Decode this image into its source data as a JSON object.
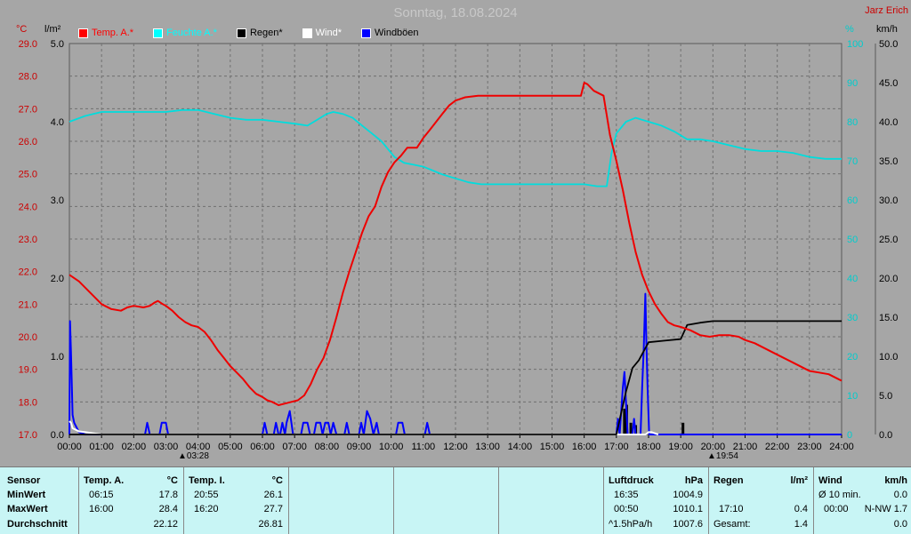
{
  "header": {
    "title": "Sonntag, 18.08.2024",
    "station": "Jarz Erich"
  },
  "units": {
    "temp": "°C",
    "rain": "l/m²",
    "humidity": "%",
    "wind": "km/h"
  },
  "legend": [
    {
      "label": "Temp. A.*",
      "color": "#ff0000"
    },
    {
      "label": "Feuchte A.*",
      "color": "#00ffff"
    },
    {
      "label": "Regen*",
      "color": "#000000"
    },
    {
      "label": "Wind*",
      "color": "#ffffff"
    },
    {
      "label": "Windböen",
      "color": "#0000ff"
    }
  ],
  "sun": {
    "rise": "03:28",
    "set": "19:54"
  },
  "chart_data": {
    "type": "line",
    "x_ticks": [
      "00:00",
      "01:00",
      "02:00",
      "03:00",
      "04:00",
      "05:00",
      "06:00",
      "07:00",
      "08:00",
      "09:00",
      "10:00",
      "11:00",
      "12:00",
      "13:00",
      "14:00",
      "15:00",
      "16:00",
      "17:00",
      "18:00",
      "19:00",
      "20:00",
      "21:00",
      "22:00",
      "23:00",
      "24:00"
    ],
    "axes": {
      "temp": {
        "ticks": [
          "17.0",
          "18.0",
          "19.0",
          "20.0",
          "21.0",
          "22.0",
          "23.0",
          "24.0",
          "25.0",
          "26.0",
          "27.0",
          "28.0",
          "29.0"
        ],
        "range": [
          17,
          29
        ]
      },
      "rain": {
        "ticks": [
          "0.0",
          "1.0",
          "2.0",
          "3.0",
          "4.0",
          "5.0"
        ],
        "range": [
          0,
          5
        ]
      },
      "humidity": {
        "ticks": [
          "0",
          "10",
          "20",
          "30",
          "40",
          "50",
          "60",
          "70",
          "80",
          "90",
          "100"
        ],
        "range": [
          0,
          100
        ]
      },
      "wind": {
        "ticks": [
          "0.0",
          "5.0",
          "10.0",
          "15.0",
          "20.0",
          "25.0",
          "30.0",
          "35.0",
          "40.0",
          "45.0",
          "50.0"
        ],
        "range": [
          0,
          50
        ]
      }
    },
    "series": [
      {
        "name": "Temp. A.*",
        "color": "#ee0000",
        "axis": "temp",
        "points": [
          [
            0,
            21.9
          ],
          [
            0.3,
            21.7
          ],
          [
            0.7,
            21.3
          ],
          [
            1,
            21.0
          ],
          [
            1.3,
            20.85
          ],
          [
            1.6,
            20.8
          ],
          [
            1.8,
            20.9
          ],
          [
            2,
            20.95
          ],
          [
            2.3,
            20.9
          ],
          [
            2.5,
            20.95
          ],
          [
            2.65,
            21.05
          ],
          [
            2.75,
            21.1
          ],
          [
            2.9,
            21.0
          ],
          [
            3,
            20.95
          ],
          [
            3.2,
            20.8
          ],
          [
            3.4,
            20.6
          ],
          [
            3.6,
            20.45
          ],
          [
            3.8,
            20.35
          ],
          [
            4,
            20.3
          ],
          [
            4.2,
            20.15
          ],
          [
            4.4,
            19.9
          ],
          [
            4.6,
            19.6
          ],
          [
            4.8,
            19.35
          ],
          [
            5,
            19.1
          ],
          [
            5.2,
            18.9
          ],
          [
            5.4,
            18.7
          ],
          [
            5.6,
            18.45
          ],
          [
            5.8,
            18.25
          ],
          [
            6,
            18.15
          ],
          [
            6.15,
            18.05
          ],
          [
            6.3,
            18.0
          ],
          [
            6.5,
            17.9
          ],
          [
            6.7,
            17.95
          ],
          [
            6.9,
            18.0
          ],
          [
            7.1,
            18.05
          ],
          [
            7.3,
            18.2
          ],
          [
            7.5,
            18.55
          ],
          [
            7.7,
            19.0
          ],
          [
            7.9,
            19.35
          ],
          [
            8.1,
            19.9
          ],
          [
            8.3,
            20.6
          ],
          [
            8.5,
            21.35
          ],
          [
            8.7,
            22.0
          ],
          [
            8.9,
            22.6
          ],
          [
            9.1,
            23.2
          ],
          [
            9.3,
            23.7
          ],
          [
            9.5,
            24.0
          ],
          [
            9.7,
            24.6
          ],
          [
            9.9,
            25.05
          ],
          [
            10.1,
            25.35
          ],
          [
            10.3,
            25.55
          ],
          [
            10.5,
            25.8
          ],
          [
            10.8,
            25.8
          ],
          [
            11,
            26.1
          ],
          [
            11.2,
            26.35
          ],
          [
            11.4,
            26.6
          ],
          [
            11.6,
            26.85
          ],
          [
            11.8,
            27.1
          ],
          [
            12,
            27.25
          ],
          [
            12.3,
            27.35
          ],
          [
            12.7,
            27.4
          ],
          [
            13,
            27.4
          ],
          [
            14,
            27.4
          ],
          [
            15,
            27.4
          ],
          [
            15.9,
            27.4
          ],
          [
            16,
            27.8
          ],
          [
            16.1,
            27.75
          ],
          [
            16.3,
            27.55
          ],
          [
            16.6,
            27.4
          ],
          [
            16.8,
            26.2
          ],
          [
            17,
            25.4
          ],
          [
            17.2,
            24.5
          ],
          [
            17.4,
            23.5
          ],
          [
            17.6,
            22.6
          ],
          [
            17.8,
            21.9
          ],
          [
            18,
            21.4
          ],
          [
            18.2,
            21.0
          ],
          [
            18.4,
            20.7
          ],
          [
            18.6,
            20.45
          ],
          [
            18.8,
            20.35
          ],
          [
            19,
            20.3
          ],
          [
            19.3,
            20.2
          ],
          [
            19.6,
            20.05
          ],
          [
            19.9,
            20.0
          ],
          [
            20.2,
            20.05
          ],
          [
            20.5,
            20.05
          ],
          [
            20.8,
            20.0
          ],
          [
            21,
            19.9
          ],
          [
            21.3,
            19.8
          ],
          [
            21.6,
            19.65
          ],
          [
            21.9,
            19.5
          ],
          [
            22.2,
            19.35
          ],
          [
            22.5,
            19.2
          ],
          [
            22.8,
            19.05
          ],
          [
            23,
            18.95
          ],
          [
            23.3,
            18.9
          ],
          [
            23.6,
            18.85
          ],
          [
            23.9,
            18.7
          ],
          [
            24,
            18.65
          ]
        ]
      },
      {
        "name": "Feuchte A.*",
        "color": "#00dddd",
        "axis": "humidity",
        "points": [
          [
            0,
            80
          ],
          [
            0.5,
            81.5
          ],
          [
            1,
            82.5
          ],
          [
            1.5,
            82.5
          ],
          [
            2,
            82.5
          ],
          [
            2.5,
            82.5
          ],
          [
            3,
            82.5
          ],
          [
            3.5,
            83
          ],
          [
            4,
            83
          ],
          [
            4.5,
            82
          ],
          [
            5,
            81
          ],
          [
            5.5,
            80.5
          ],
          [
            6,
            80.5
          ],
          [
            6.5,
            80
          ],
          [
            7,
            79.5
          ],
          [
            7.4,
            79
          ],
          [
            7.6,
            80
          ],
          [
            7.8,
            81
          ],
          [
            8,
            82
          ],
          [
            8.2,
            82.5
          ],
          [
            8.5,
            82
          ],
          [
            8.8,
            81
          ],
          [
            9.1,
            79
          ],
          [
            9.4,
            77
          ],
          [
            9.7,
            75
          ],
          [
            9.9,
            73
          ],
          [
            10.1,
            71
          ],
          [
            10.4,
            69.5
          ],
          [
            10.7,
            69
          ],
          [
            11,
            68.5
          ],
          [
            11.3,
            67.5
          ],
          [
            11.6,
            66.5
          ],
          [
            12,
            65.5
          ],
          [
            12.4,
            64.5
          ],
          [
            12.8,
            64
          ],
          [
            13.5,
            64
          ],
          [
            14.5,
            64
          ],
          [
            15.5,
            64
          ],
          [
            16,
            64
          ],
          [
            16.4,
            63.5
          ],
          [
            16.7,
            63.5
          ],
          [
            16.85,
            72
          ],
          [
            17,
            77
          ],
          [
            17.3,
            80
          ],
          [
            17.6,
            81
          ],
          [
            18,
            80
          ],
          [
            18.4,
            79
          ],
          [
            18.8,
            77.5
          ],
          [
            19.2,
            75.5
          ],
          [
            19.6,
            75.5
          ],
          [
            20,
            75
          ],
          [
            20.5,
            74
          ],
          [
            21,
            73
          ],
          [
            21.5,
            72.5
          ],
          [
            22,
            72.5
          ],
          [
            22.5,
            72
          ],
          [
            23,
            71
          ],
          [
            23.5,
            70.5
          ],
          [
            24,
            70.5
          ]
        ]
      },
      {
        "name": "Regen*",
        "color": "#000000",
        "axis": "rain",
        "points": [
          [
            0,
            0
          ],
          [
            17,
            0
          ],
          [
            17.3,
            0.55
          ],
          [
            17.5,
            0.85
          ],
          [
            17.7,
            0.95
          ],
          [
            18,
            1.18
          ],
          [
            18.5,
            1.2
          ],
          [
            19,
            1.22
          ],
          [
            19.2,
            1.4
          ],
          [
            19.6,
            1.43
          ],
          [
            20,
            1.45
          ],
          [
            21,
            1.45
          ],
          [
            22,
            1.45
          ],
          [
            23,
            1.45
          ],
          [
            24,
            1.45
          ]
        ]
      },
      {
        "name": "Wind*",
        "color": "#ffffff",
        "axis": "wind",
        "points": [
          [
            0,
            1.7
          ],
          [
            0.05,
            1.5
          ],
          [
            0.1,
            0.8
          ],
          [
            0.2,
            0.6
          ],
          [
            0.3,
            0.4
          ],
          [
            0.5,
            0.3
          ],
          [
            1,
            0
          ],
          [
            17.9,
            0
          ],
          [
            18,
            0.3
          ],
          [
            18.1,
            0.3
          ],
          [
            18.3,
            0
          ]
        ]
      },
      {
        "name": "Windböen",
        "color": "#0000ff",
        "axis": "wind",
        "points": [
          [
            0,
            0
          ],
          [
            0.02,
            14.5
          ],
          [
            0.05,
            10.5
          ],
          [
            0.1,
            2.5
          ],
          [
            0.15,
            1.5
          ],
          [
            0.3,
            0.3
          ],
          [
            0.5,
            0
          ],
          [
            2.35,
            0
          ],
          [
            2.42,
            1.5
          ],
          [
            2.5,
            0
          ],
          [
            2.8,
            0
          ],
          [
            2.87,
            1.5
          ],
          [
            3.0,
            1.5
          ],
          [
            3.07,
            0
          ],
          [
            6.0,
            0
          ],
          [
            6.07,
            1.5
          ],
          [
            6.15,
            0
          ],
          [
            6.35,
            0
          ],
          [
            6.42,
            1.5
          ],
          [
            6.5,
            0
          ],
          [
            6.55,
            0
          ],
          [
            6.62,
            1.5
          ],
          [
            6.7,
            0
          ],
          [
            6.75,
            1.5
          ],
          [
            6.85,
            3.0
          ],
          [
            6.95,
            0
          ],
          [
            7.2,
            0
          ],
          [
            7.27,
            1.5
          ],
          [
            7.4,
            1.5
          ],
          [
            7.48,
            0
          ],
          [
            7.6,
            0
          ],
          [
            7.67,
            1.5
          ],
          [
            7.8,
            1.5
          ],
          [
            7.87,
            0
          ],
          [
            7.95,
            1.5
          ],
          [
            8.05,
            1.5
          ],
          [
            8.12,
            0
          ],
          [
            8.2,
            1.5
          ],
          [
            8.3,
            0
          ],
          [
            8.55,
            0
          ],
          [
            8.62,
            1.5
          ],
          [
            8.7,
            0
          ],
          [
            9.0,
            0
          ],
          [
            9.07,
            1.5
          ],
          [
            9.15,
            0
          ],
          [
            9.25,
            3.0
          ],
          [
            9.35,
            2.0
          ],
          [
            9.45,
            0
          ],
          [
            9.55,
            1.5
          ],
          [
            9.62,
            0
          ],
          [
            10.15,
            0
          ],
          [
            10.22,
            1.5
          ],
          [
            10.35,
            1.5
          ],
          [
            10.42,
            0
          ],
          [
            11.05,
            0
          ],
          [
            11.12,
            1.5
          ],
          [
            11.2,
            0
          ],
          [
            17.0,
            0
          ],
          [
            17.05,
            2.0
          ],
          [
            17.1,
            0
          ],
          [
            17.2,
            6.0
          ],
          [
            17.25,
            8.0
          ],
          [
            17.3,
            4.0
          ],
          [
            17.35,
            0
          ],
          [
            17.5,
            0
          ],
          [
            17.55,
            2.0
          ],
          [
            17.6,
            0
          ],
          [
            17.75,
            0
          ],
          [
            17.8,
            6.0
          ],
          [
            17.85,
            11.0
          ],
          [
            17.9,
            18.0
          ],
          [
            17.93,
            12.0
          ],
          [
            17.97,
            6.0
          ],
          [
            18.02,
            0
          ],
          [
            24,
            0
          ]
        ]
      }
    ],
    "rain_bars": [
      [
        17.25,
        0.33
      ],
      [
        17.32,
        0.38
      ],
      [
        17.45,
        0.15
      ],
      [
        17.6,
        0.12
      ],
      [
        19.07,
        0.15
      ]
    ]
  },
  "stats": {
    "sensor": {
      "header": "Sensor",
      "rows": [
        "MinWert",
        "MaxWert",
        "Durchschnitt"
      ]
    },
    "temp_a": {
      "header": "Temp. A.",
      "unit": "°C",
      "rows": [
        [
          "06:15",
          "17.8"
        ],
        [
          "16:00",
          "28.4"
        ],
        [
          "",
          "22.12"
        ]
      ]
    },
    "temp_i": {
      "header": "Temp. I.",
      "unit": "°C",
      "rows": [
        [
          "20:55",
          "26.1"
        ],
        [
          "16:20",
          "27.7"
        ],
        [
          "",
          "26.81"
        ]
      ]
    },
    "pressure": {
      "header": "Luftdruck",
      "unit": "hPa",
      "rows": [
        [
          "16:35",
          "1004.9"
        ],
        [
          "00:50",
          "1010.1"
        ],
        [
          "^1.5hPa/h",
          "1007.6"
        ]
      ]
    },
    "rain": {
      "header": "Regen",
      "unit": "l/m²",
      "rows": [
        [
          "",
          ""
        ],
        [
          "17:10",
          "0.4"
        ],
        [
          "Gesamt:",
          "1.4"
        ]
      ]
    },
    "wind": {
      "header": "Wind",
      "unit": "km/h",
      "rows": [
        [
          "Ø 10 min.",
          "0.0"
        ],
        [
          "00:00",
          "N-NW 1.7"
        ],
        [
          "",
          "0.0"
        ]
      ]
    }
  }
}
